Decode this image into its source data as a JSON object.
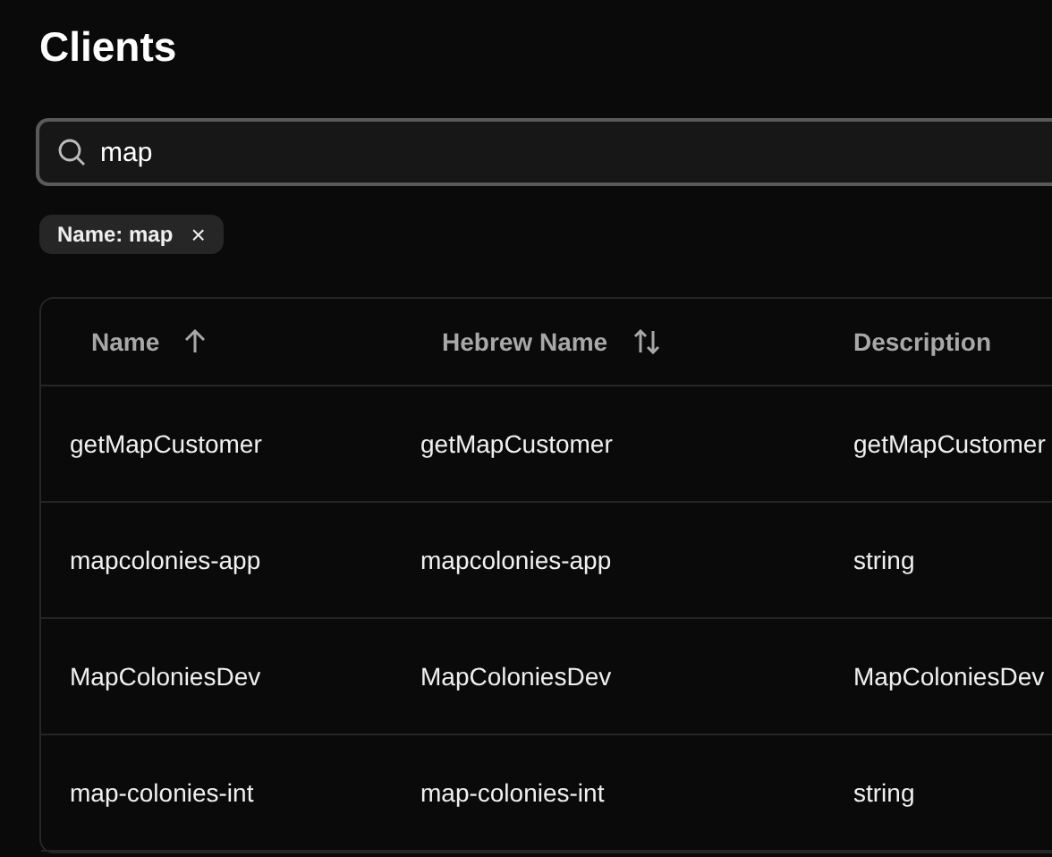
{
  "title": "Clients",
  "search": {
    "value": "map"
  },
  "filters": [
    {
      "label": "Name: map",
      "remove": "×"
    }
  ],
  "table": {
    "columns": [
      {
        "label": "Name",
        "sorted": true
      },
      {
        "label": "Hebrew Name",
        "sorted": false
      },
      {
        "label": "Description"
      }
    ],
    "rows": [
      [
        "getMapCustomer",
        "getMapCustomer",
        "getMapCustomer"
      ],
      [
        "mapcolonies-app",
        "mapcolonies-app",
        "string"
      ],
      [
        "MapColoniesDev",
        "MapColoniesDev",
        "MapColoniesDev"
      ],
      [
        "map-colonies-int",
        "map-colonies-int",
        "string"
      ]
    ]
  }
}
